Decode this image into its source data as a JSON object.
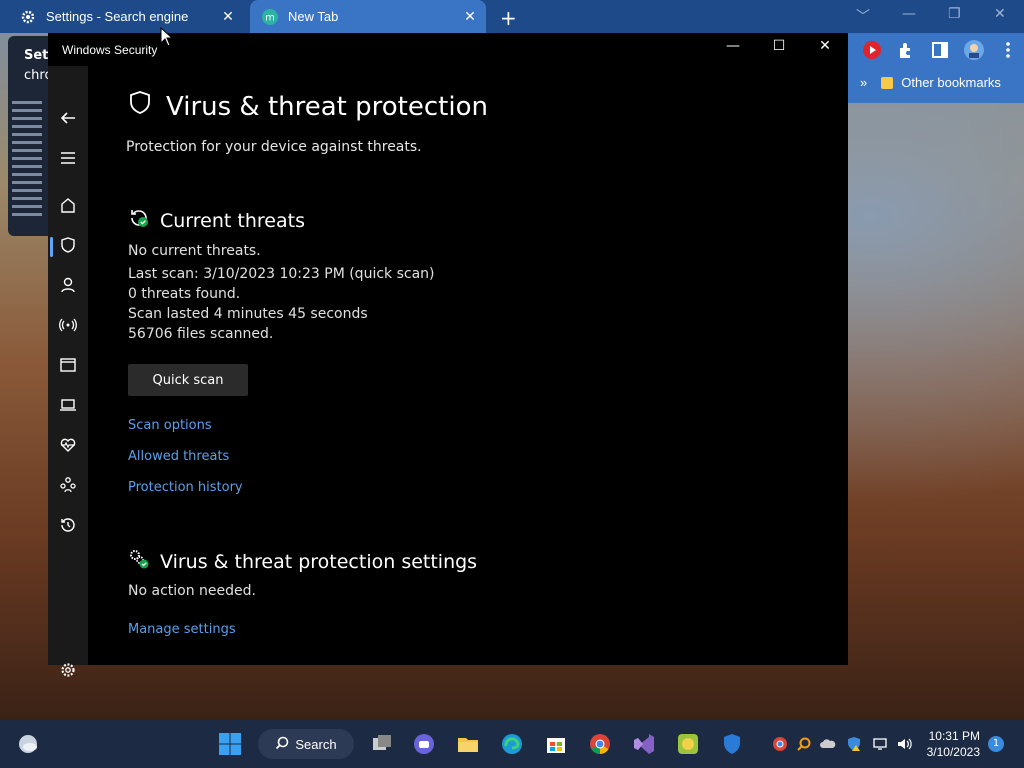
{
  "browser": {
    "tab1_label": "Settings - Search engine",
    "tab2_label": "New Tab",
    "bookmarks_label": "Other bookmarks",
    "bookmarks_more": "»"
  },
  "background_window": {
    "title_partial": "Sett",
    "subtitle_partial": "chro"
  },
  "window": {
    "title": "Windows Security"
  },
  "page": {
    "title": "Virus & threat protection",
    "subtitle": "Protection for your device against threats."
  },
  "current_threats": {
    "heading": "Current threats",
    "status": "No current threats.",
    "last_scan": "Last scan: 3/10/2023 10:23 PM (quick scan)",
    "threats_found": "0 threats found.",
    "scan_duration": "Scan lasted 4 minutes 45 seconds",
    "files_scanned": "56706 files scanned.",
    "quick_scan_label": "Quick scan",
    "links": [
      "Scan options",
      "Allowed threats",
      "Protection history"
    ]
  },
  "settings_section": {
    "heading": "Virus & threat protection settings",
    "status": "No action needed.",
    "link": "Manage settings"
  },
  "taskbar": {
    "search_label": "Search",
    "time": "10:31 PM",
    "date": "3/10/2023",
    "notification_count": "1"
  },
  "colors": {
    "accent_link": "#5aa0ea",
    "window_bg": "#000000",
    "nav_bg": "#1a1a1a",
    "browser_bar": "#1e4a8a",
    "taskbar": "#1c2a44"
  }
}
